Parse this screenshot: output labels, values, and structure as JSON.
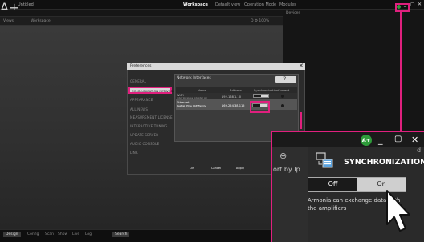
{
  "app": {
    "logo": "A+",
    "title": "Untitled"
  },
  "nav": [
    {
      "label": "Workspace",
      "active": true
    },
    {
      "label": "Default view",
      "active": false
    },
    {
      "label": "Operation Mode",
      "active": false
    },
    {
      "label": "Modules",
      "active": false
    }
  ],
  "window_controls": {
    "minimize": "_",
    "maximize": "▢",
    "close": "✕"
  },
  "viewbar": {
    "left": "Views",
    "center": "Workspace",
    "right": "Q  ⚙  100%"
  },
  "right_panel": {
    "header": "Devices"
  },
  "bottom_tabs": [
    {
      "label": "Design",
      "selected": true
    },
    {
      "label": "Config",
      "selected": false
    },
    {
      "label": "Scan",
      "selected": false
    },
    {
      "label": "Show",
      "selected": false
    },
    {
      "label": "Live",
      "selected": false
    },
    {
      "label": "Log",
      "selected": false
    },
    {
      "label": "Search",
      "selected": false
    }
  ],
  "dialog": {
    "title": "Preferences",
    "close": "✕",
    "sidebar": [
      "GENERAL",
      "COMMUNICATION NETWORK",
      "APPEARANCE",
      "ALL NEWS",
      "MEASUREMENT LICENSE",
      "INTERACTIVE TUNING",
      "UPDATE SERVER",
      "AUDIO CONSOLE",
      "LINK"
    ],
    "selected_sidebar": "COMMUNICATION NETWORK",
    "panel_title": "Network Interfaces",
    "help": "?",
    "columns": [
      "Name",
      "Address",
      "Synchronization",
      "Current"
    ],
    "rows": [
      {
        "name": "Wi-Fi",
        "sub": "Intel Wireless Adapter AC",
        "address": "192.168.1.10",
        "sync": "On"
      },
      {
        "name": "Ethernet",
        "sub": "Realtek PCIe GbE Family",
        "address": "169.254.38.115",
        "sync": "On"
      }
    ],
    "buttons": [
      "OK",
      "Cancel",
      "Apply"
    ]
  },
  "zoom": {
    "avatar": "A+",
    "sort_label": "ort by Ip",
    "sync_title": "SYNCHRONIZATION",
    "off_label": "Off",
    "on_label": "On",
    "state": "On",
    "description": "Armonia can exchange data with the amplifiers",
    "right_fragment": "d"
  },
  "colors": {
    "highlight": "#e0207e",
    "avatar": "#2e9b3a"
  }
}
